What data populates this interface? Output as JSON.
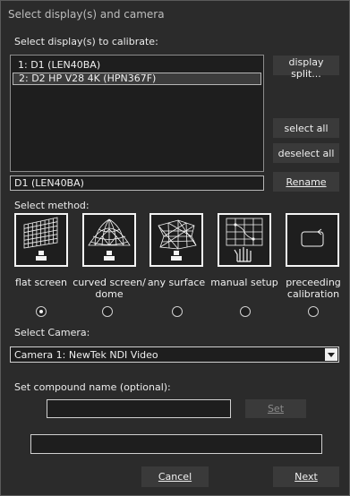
{
  "window": {
    "title": "Select display(s) and camera"
  },
  "displays": {
    "section_label": "Select display(s) to calibrate:",
    "items": [
      "1: D1  (LEN40BA)",
      "2: D2 HP V28 4K (HPN367F)"
    ],
    "selected_index": 1,
    "display_split_label": "display split...",
    "select_all_label": "select all",
    "deselect_all_label": "deselect all",
    "name_value": "D1  (LEN40BA)",
    "rename_label": "Rename"
  },
  "method": {
    "section_label": "Select method:",
    "options": [
      {
        "label_line1": "flat screen",
        "label_line2": "",
        "icon": "flat-screen-mesh-icon",
        "selected": true
      },
      {
        "label_line1": "curved screen/",
        "label_line2": "dome",
        "icon": "dome-mesh-icon",
        "selected": false
      },
      {
        "label_line1": "any surface",
        "label_line2": "",
        "icon": "any-surface-mesh-icon",
        "selected": false
      },
      {
        "label_line1": "manual setup",
        "label_line2": "",
        "icon": "manual-setup-hand-icon",
        "selected": false
      },
      {
        "label_line1": "preceeding",
        "label_line2": "calibration",
        "icon": "preceeding-calibration-icon",
        "selected": false
      }
    ]
  },
  "camera": {
    "section_label": "Select Camera:",
    "selected": "Camera 1: NewTek NDI Video"
  },
  "compound": {
    "section_label": "Set compound name (optional):",
    "name_value": "",
    "set_label": "Set",
    "status_value": ""
  },
  "footer": {
    "cancel_label": "Cancel",
    "next_label": "Next"
  },
  "colors": {
    "background": "#2b2b2b",
    "button": "#3a3a3a",
    "field": "#1e1e1e",
    "text": "#f0f0f0"
  }
}
